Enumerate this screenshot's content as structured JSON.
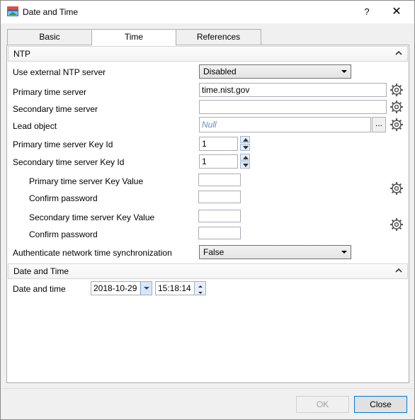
{
  "window": {
    "title": "Date and Time",
    "help_label": "?",
    "close_label": "✕"
  },
  "tabs": [
    {
      "label": "Basic",
      "active": false
    },
    {
      "label": "Time",
      "active": true
    },
    {
      "label": "References",
      "active": false
    }
  ],
  "ntp": {
    "header": "NTP",
    "use_external_label": "Use external NTP server",
    "use_external_value": "Disabled",
    "primary_server_label": "Primary time server",
    "primary_server_value": "time.nist.gov",
    "secondary_server_label": "Secondary time server",
    "secondary_server_value": "",
    "lead_object_label": "Lead object",
    "lead_object_value": "Null",
    "lead_browse_label": "...",
    "primary_key_id_label": "Primary time server Key Id",
    "primary_key_id_value": "1",
    "secondary_key_id_label": "Secondary time server Key Id",
    "secondary_key_id_value": "1",
    "primary_key_value_label": "Primary time server Key Value",
    "primary_confirm_label": "Confirm password",
    "secondary_key_value_label": "Secondary time server Key Value",
    "secondary_confirm_label": "Confirm password",
    "auth_label": "Authenticate network time synchronization",
    "auth_value": "False"
  },
  "datetime": {
    "header": "Date and Time",
    "label": "Date and time",
    "date_value": "2018-10-29",
    "time_value": "15:18:14"
  },
  "footer": {
    "ok_label": "OK",
    "close_label": "Close"
  },
  "icons": {
    "gear": "gear-icon",
    "chevron": "chevron-up-icon"
  }
}
